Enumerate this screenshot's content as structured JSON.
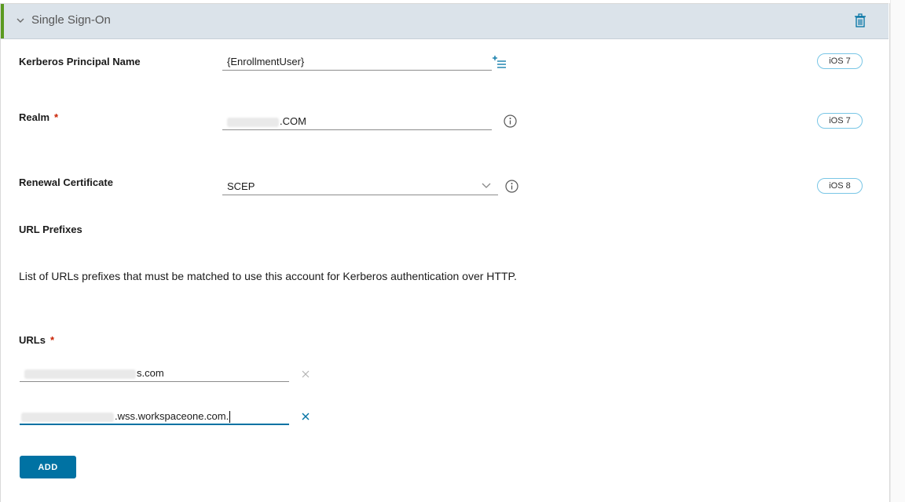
{
  "section": {
    "title": "Single Sign-On"
  },
  "fields": {
    "kerberos": {
      "label": "Kerberos Principal Name",
      "value": "{EnrollmentUser}",
      "badge": "iOS 7"
    },
    "realm": {
      "label": "Realm",
      "required": "*",
      "value_suffix": ".COM",
      "badge": "iOS 7"
    },
    "renewal": {
      "label": "Renewal Certificate",
      "value": "SCEP",
      "badge": "iOS 8"
    }
  },
  "url_prefixes": {
    "heading": "URL Prefixes",
    "description": "List of URLs prefixes that must be matched to use this account for Kerberos authentication over HTTP."
  },
  "urls": {
    "label": "URLs",
    "required": "*",
    "items": [
      {
        "value_suffix": "s.com"
      },
      {
        "value_suffix": ".wss.workspaceone.com."
      }
    ]
  },
  "add_button": {
    "label": "ADD"
  },
  "colors": {
    "accent": "#5a9a21",
    "primary": "#0072a3",
    "required": "#c92100",
    "header_bg": "#dbe3ea"
  }
}
